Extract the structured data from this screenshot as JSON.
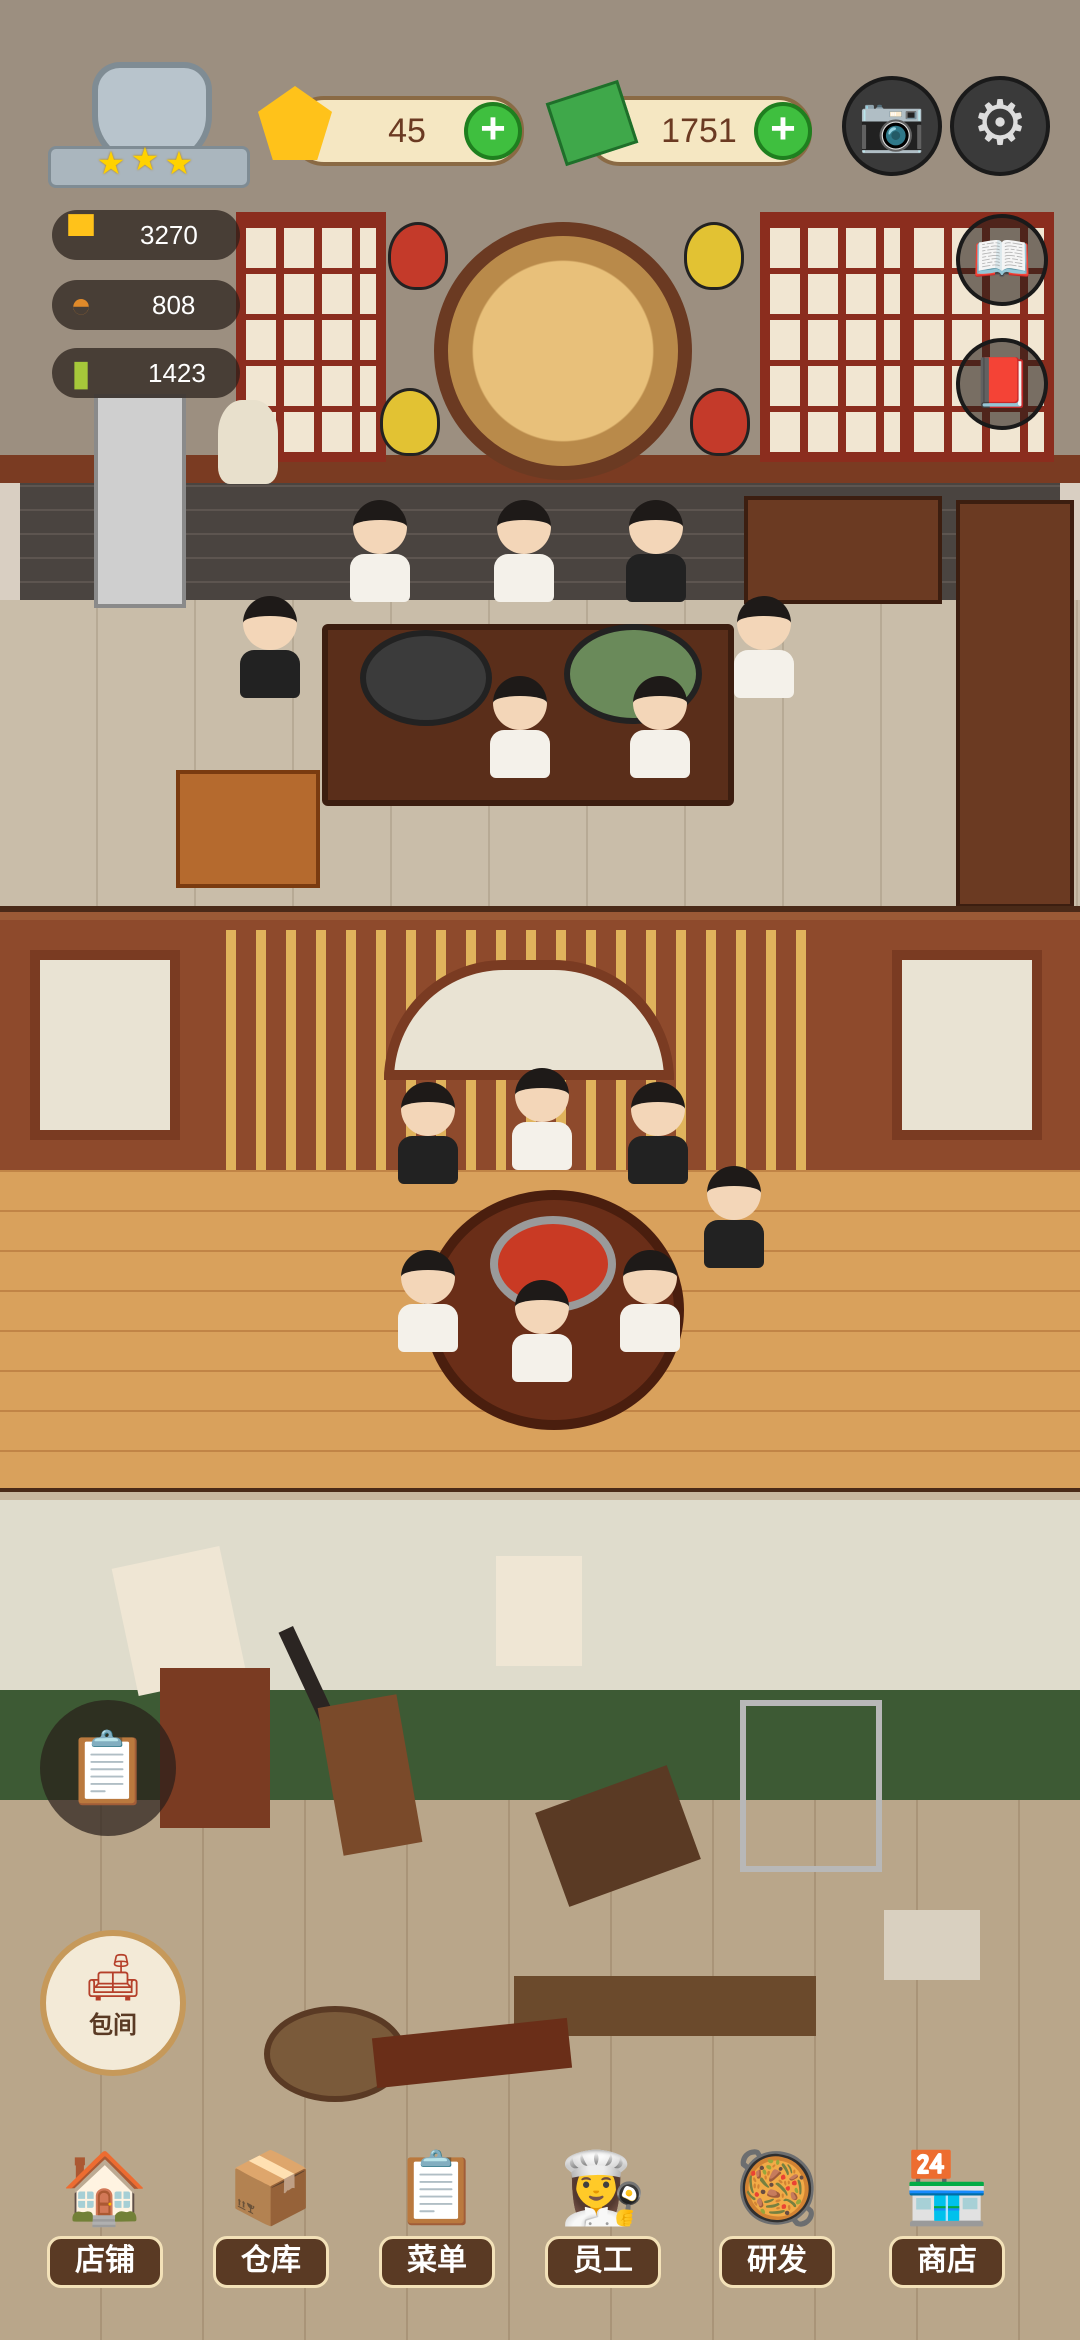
{
  "hud": {
    "gems": "45",
    "cash": "1751",
    "rating_stars": 3,
    "stats": [
      {
        "icon": "chef-hat-icon",
        "value": "3270"
      },
      {
        "icon": "serving-tray-icon",
        "value": "808"
      },
      {
        "icon": "recipe-book-icon",
        "value": "1423"
      }
    ]
  },
  "side_buttons": {
    "room_label": "包间"
  },
  "bottom_nav": [
    {
      "label": "店铺",
      "icon": "shop-building-icon"
    },
    {
      "label": "仓库",
      "icon": "warehouse-boxes-icon"
    },
    {
      "label": "菜单",
      "icon": "menu-clipboard-icon"
    },
    {
      "label": "员工",
      "icon": "staff-chef-icon"
    },
    {
      "label": "研发",
      "icon": "research-wok-icon"
    },
    {
      "label": "商店",
      "icon": "store-front-icon"
    }
  ],
  "colors": {
    "accent_green": "#3fbf3f",
    "wood_red": "#8b2d1e",
    "gold": "#ffd200"
  }
}
